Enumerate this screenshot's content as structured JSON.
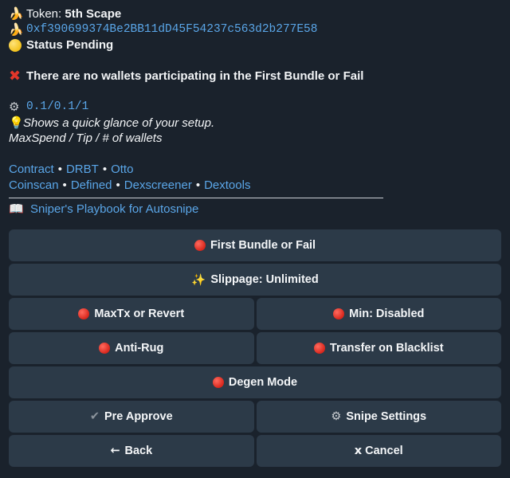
{
  "message": {
    "token_label": "Token:",
    "token_name": "5th Scape",
    "token_address": "0xf390699374Be2BB11dD45F54237c563d2b277E58",
    "status": "Status Pending",
    "warning": "There are no wallets participating in the First Bundle or Fail",
    "setup_values": "0.1/0.1/1",
    "setup_hint": "Shows a quick glance of your setup.",
    "setup_legend": "MaxSpend / Tip / # of wallets",
    "links_row1": [
      "Contract",
      "DRBT",
      "Otto"
    ],
    "links_row2": [
      "Coinscan",
      "Defined",
      "Dexscreener",
      "Dextools"
    ],
    "separator": "•",
    "playbook_link": "Sniper's Playbook for Autosnipe",
    "icons": {
      "token": "banana-icon",
      "address": "banana-icon",
      "status": "yellow-circle-icon",
      "warning": "red-cross-icon",
      "setup": "gear-icon",
      "hint": "light-bulb-icon",
      "playbook": "open-book-icon"
    }
  },
  "keyboard": {
    "first_bundle": "First Bundle or Fail",
    "slippage": "Slippage: Unlimited",
    "maxtx": "MaxTx or Revert",
    "min": "Min: Disabled",
    "antirug": "Anti-Rug",
    "transfer_blacklist": "Transfer on Blacklist",
    "degen": "Degen Mode",
    "pre_approve": "Pre Approve",
    "snipe_settings": "Snipe Settings",
    "back": "Back",
    "cancel": "Cancel"
  },
  "colors": {
    "background": "#1a222c",
    "button": "#2c3a48",
    "link": "#5aa6e8",
    "off_indicator": "#d8261c"
  }
}
